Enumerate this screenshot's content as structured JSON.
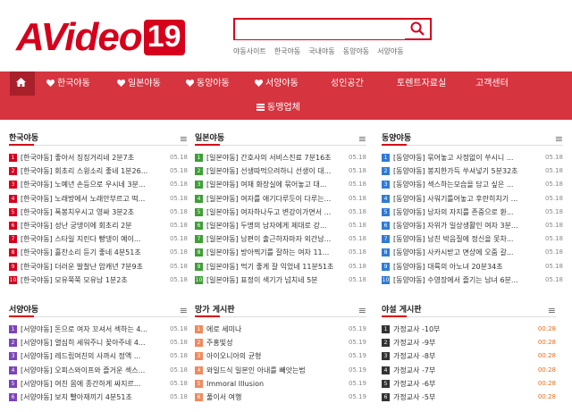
{
  "header": {
    "logo_text": "AVideo",
    "logo_badge": "19",
    "search_placeholder": "",
    "quick_links": [
      "야동사이트",
      "한국야동",
      "국내야동",
      "동양야동",
      "서양야동"
    ]
  },
  "nav": {
    "row1": [
      "한국야동",
      "일본야동",
      "동양야동",
      "서양야동",
      "성인공간",
      "토렌트자료실",
      "고객센터"
    ],
    "row2": [
      "동맹업체"
    ]
  },
  "panels": [
    {
      "title": "한국야동",
      "items": [
        [
          "[한국야동] 좋아서 징징거리네 2분7초",
          "05.18"
        ],
        [
          "[한국야동] 회초리 스윙소리 좋네 1분26...",
          "05.18"
        ],
        [
          "[한국야동] 노예년 손등으로 우시네 3분...",
          "05.18"
        ],
        [
          "[한국야동] 노래방에서 노래안부르고 떡...",
          "05.18"
        ],
        [
          "[한국야동] 폭봉치우시고 영싸 3분2초",
          "05.18"
        ],
        [
          "[한국야동] 성난 궁댕이에 회초리 2분",
          "05.18"
        ],
        [
          "[한국야동] 스타일 지린다 빵댕이 예이...",
          "05.18"
        ],
        [
          "[한국야동] 흘찬소리 듣기 좋네 4분51초",
          "05.18"
        ],
        [
          "[한국야동] 더러운 발찰난 암캐년 7분9초",
          "05.18"
        ],
        [
          "[한국야동] 모유쭉쭉 모유남 1분2초",
          "05.18"
        ]
      ]
    },
    {
      "title": "일본야동",
      "items": [
        [
          "[일본야동] 간호사의 서비스진료 7분16초",
          "05.18"
        ],
        [
          "[일본야동] 선생따먹으려하니 선생이 대...",
          "05.18"
        ],
        [
          "[일본야동] 여재 화장실에 묶어놓고 대...",
          "05.18"
        ],
        [
          "[일본야동] 여자를 애기다루듯이 다루는...",
          "05.18"
        ],
        [
          "[일본야동] 여자하나두고 변강이가면서 ...",
          "05.18"
        ],
        [
          "[일본야동] 두명의 남자에게 제대로 강...",
          "05.18"
        ],
        [
          "[일본야동] 남편이 출근하자마자 외간남...",
          "05.18"
        ],
        [
          "[일본야동] 방아찍기를 잘하는 여자 11...",
          "05.18"
        ],
        [
          "[일본야동] 먹기 좋게 잘 익었네 11분51초",
          "05.18"
        ],
        [
          "[일본야동] 표정이 색기가 넘치네 5분",
          "05.18"
        ]
      ]
    },
    {
      "title": "동양야동",
      "items": [
        [
          "[동양야동] 묶어놓고 사정없이 쑤시니 ...",
          "05.18"
        ],
        [
          "[동양야동] 봉지한가득 쑤셔넣기 5분32초",
          "05.18"
        ],
        [
          "[동양야동] 섹스하는모습을 담고 싶은 ...",
          "05.18"
        ],
        [
          "[동양야동] 사워기틀어놓고 후란히치기 ...",
          "05.18"
        ],
        [
          "[동양야동] 남자의 자지를 존중으로 환...",
          "05.18"
        ],
        [
          "[동양야동] 자위가 일상생활인 여자 3분...",
          "05.18"
        ],
        [
          "[동양야동] 남친 박음질에 정신을 못차...",
          "05.18"
        ],
        [
          "[동양야동] 사카시받고 면상에 오줌 갈...",
          "05.18"
        ],
        [
          "[동양야동] 대륙의 아노녀 20분34초",
          "05.18"
        ],
        [
          "[동양야동] 수영장에서 즐기는 남녀 6분...",
          "05.18"
        ]
      ]
    },
    {
      "title": "서양야동",
      "items": [
        [
          "[서양야동] 돈으로 여자 꼬셔서 섹하는 4...",
          "05.18"
        ],
        [
          "[서양야동] 열심히 세워주니 꽂아주네 4...",
          "05.18"
        ],
        [
          "[서양야동] 레드립여친의 사까시 정액 ...",
          "05.18"
        ],
        [
          "[서양야동] 오피스와이프와 즐거운 섹스...",
          "05.18"
        ],
        [
          "[서양야동] 여친 몸에 종간하게 싸지르...",
          "05.18"
        ],
        [
          "[서양야동] 보지 빨아재끼기 4분51초",
          "05.18"
        ]
      ]
    },
    {
      "title": "망가 게시판",
      "items": [
        [
          "에로 세미나",
          "05.19"
        ],
        [
          "주홍빛성",
          "05.19"
        ],
        [
          "아이오니아의 균형",
          "05.19"
        ],
        [
          "와일드식 일본인 아내를 빼앗는법",
          "05.19"
        ],
        [
          "Immoral Illusion",
          "05.19"
        ],
        [
          "풀이서 여행",
          "05.19"
        ]
      ]
    },
    {
      "title": "야설 게시판",
      "items": [
        [
          "가정교사 -10부",
          "00:28"
        ],
        [
          "가정교사 -9부",
          "00:28"
        ],
        [
          "가정교사 -8부",
          "00:28"
        ],
        [
          "가정교사 -7부",
          "00:28"
        ],
        [
          "가정교사 -6부",
          "00:28"
        ],
        [
          "가정교사 -5부",
          "00:28"
        ]
      ]
    }
  ],
  "icons": {
    "home": "home-icon",
    "heart": "heart-icon",
    "list": "list-icon",
    "search": "search-icon",
    "more": "chevron-more-icon"
  },
  "colors": {
    "brand": "#d6001c",
    "nav": "#d6343f"
  }
}
